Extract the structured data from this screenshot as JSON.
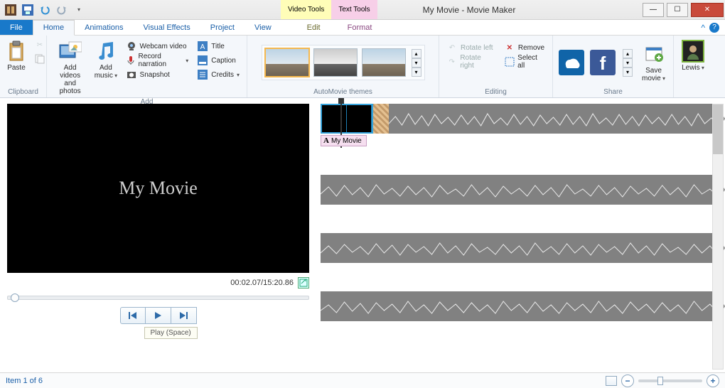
{
  "window": {
    "title": "My Movie - Movie Maker",
    "tool_tabs": {
      "video": "Video Tools",
      "text": "Text Tools"
    }
  },
  "tabs": {
    "file": "File",
    "home": "Home",
    "animations": "Animations",
    "visual_effects": "Visual Effects",
    "project": "Project",
    "view": "View",
    "edit": "Edit",
    "format": "Format"
  },
  "ribbon": {
    "clipboard": {
      "label": "Clipboard",
      "paste": "Paste"
    },
    "add": {
      "label": "Add",
      "add_videos": "Add videos\nand photos",
      "add_music": "Add\nmusic",
      "webcam": "Webcam video",
      "record": "Record narration",
      "snapshot": "Snapshot",
      "title": "Title",
      "caption": "Caption",
      "credits": "Credits"
    },
    "themes": {
      "label": "AutoMovie themes"
    },
    "editing": {
      "label": "Editing",
      "rotate_left": "Rotate left",
      "rotate_right": "Rotate right",
      "remove": "Remove",
      "select_all": "Select all"
    },
    "share": {
      "label": "Share",
      "save_movie": "Save\nmovie"
    },
    "signin": {
      "user": "Lewis"
    }
  },
  "preview": {
    "title_text": "My Movie",
    "timecode": "00:02.07/15:20.86",
    "tooltip": "Play (Space)"
  },
  "timeline": {
    "title_clip": "My Movie"
  },
  "status": {
    "left": "Item 1 of 6"
  }
}
